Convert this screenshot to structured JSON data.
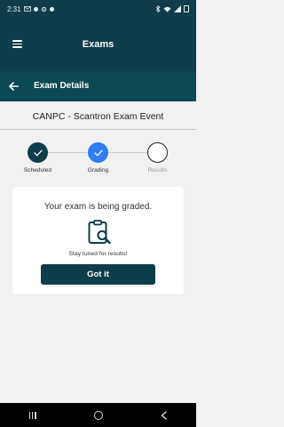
{
  "status_bar": {
    "time": "2:31",
    "left_icons": [
      "mail-icon",
      "dot-icon",
      "settings-icon",
      "dot-icon"
    ],
    "right_icons": [
      "bluetooth-icon",
      "wifi-icon",
      "signal-icon",
      "battery-icon"
    ]
  },
  "app_bar": {
    "title": "Exams"
  },
  "sub_bar": {
    "title": "Exam Details"
  },
  "exam": {
    "title": "CANPC - Scantron Exam Event"
  },
  "steps": [
    {
      "label": "Scheduled",
      "state": "complete",
      "color": "#0d3e49"
    },
    {
      "label": "Grading",
      "state": "current",
      "color": "#2e7df3"
    },
    {
      "label": "Results",
      "state": "pending",
      "color": "#9b9b9b"
    }
  ],
  "card": {
    "heading": "Your exam is being graded.",
    "subtext": "Stay tuned for results!",
    "button_label": "Got it",
    "icon": "clipboard-search-icon"
  },
  "colors": {
    "primary": "#0d3e49",
    "accent": "#2e7df3",
    "background": "#f1f1f1"
  }
}
